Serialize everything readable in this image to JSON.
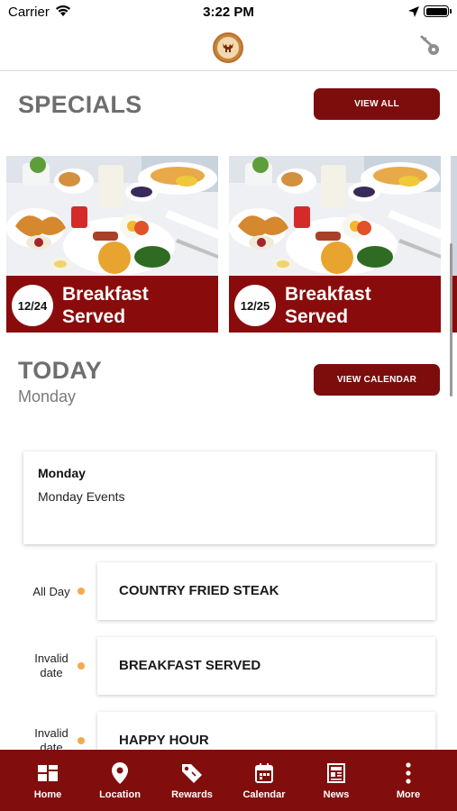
{
  "status_bar": {
    "carrier": "Carrier",
    "time": "3:22 PM"
  },
  "specials": {
    "title": "SPECIALS",
    "view_all_label": "VIEW ALL",
    "cards": [
      {
        "date": "12/24",
        "title": "Breakfast\nServed"
      },
      {
        "date": "12/25",
        "title": "Breakfast\nServed"
      }
    ]
  },
  "today": {
    "title": "TODAY",
    "day": "Monday",
    "view_calendar_label": "VIEW CALENDAR"
  },
  "day_events": {
    "title": "Monday",
    "text": "Monday Events"
  },
  "events": [
    {
      "time": "All Day",
      "name": "COUNTRY FRIED STEAK"
    },
    {
      "time": "Invalid date",
      "name": "BREAKFAST SERVED"
    },
    {
      "time": "Invalid date",
      "name": "HAPPY HOUR"
    }
  ],
  "tab_bar": {
    "items": [
      {
        "label": "Home",
        "icon": "home-grid-icon"
      },
      {
        "label": "Location",
        "icon": "map-pin-icon"
      },
      {
        "label": "Rewards",
        "icon": "tag-icon"
      },
      {
        "label": "Calendar",
        "icon": "calendar-icon"
      },
      {
        "label": "News",
        "icon": "newspaper-icon"
      },
      {
        "label": "More",
        "icon": "more-vertical-icon"
      }
    ]
  },
  "colors": {
    "brand": "#820d0d",
    "title_gray": "#6e6e6e",
    "event_dot": "#f4a94e"
  }
}
